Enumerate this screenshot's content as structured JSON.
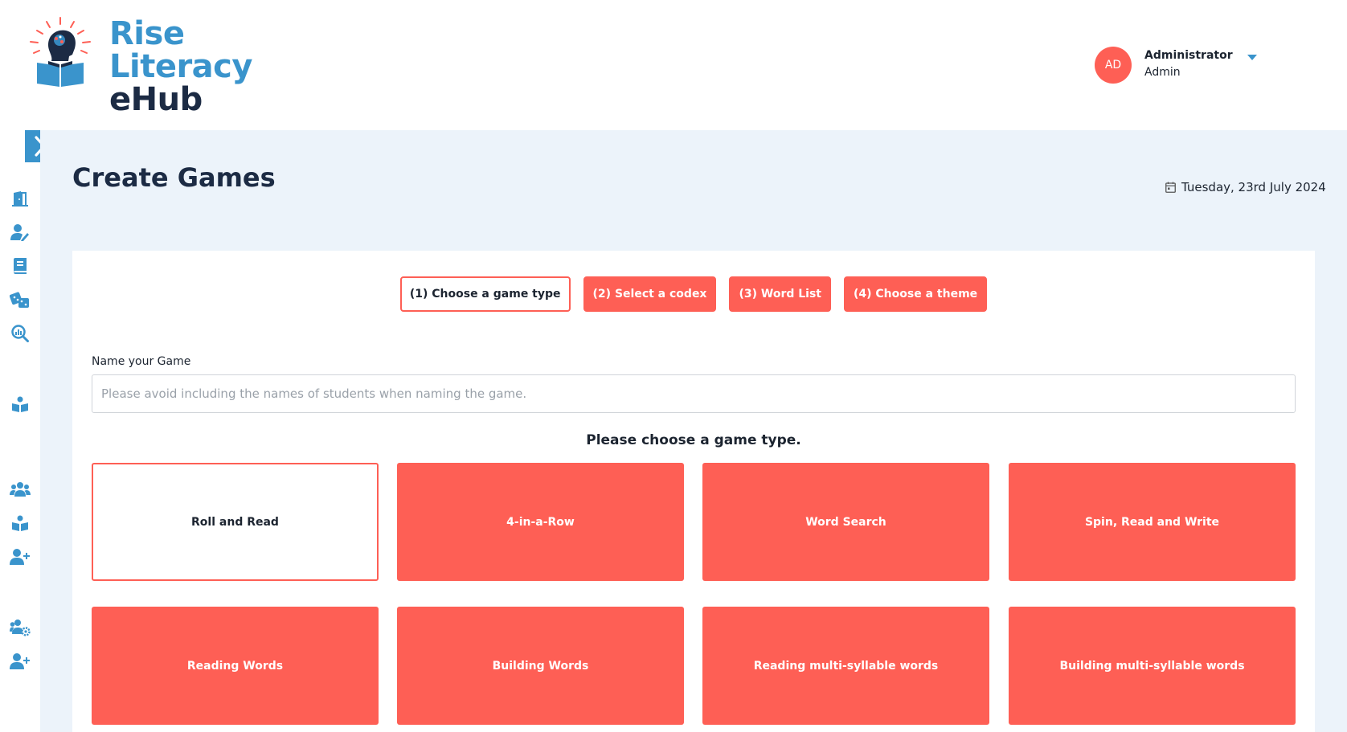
{
  "brand": {
    "line1": "Rise",
    "line2": "Literacy",
    "line3": "eHub",
    "primary_color": "#3a94cc",
    "accent_color": "#fe5f55",
    "dark_color": "#1c2b44"
  },
  "user": {
    "initials": "AD",
    "name": "Administrator",
    "role": "Admin"
  },
  "sidebar": {
    "toggle_icon": "double-chevron-right-icon",
    "items": [
      {
        "icon": "door-icon"
      },
      {
        "icon": "user-edit-icon"
      },
      {
        "icon": "book-icon"
      },
      {
        "icon": "dice-icon"
      },
      {
        "icon": "search-chart-icon"
      },
      {
        "icon": "reading-icon"
      },
      {
        "icon": "users-icon"
      },
      {
        "icon": "reading-icon"
      },
      {
        "icon": "user-plus-icon"
      },
      {
        "icon": "users-cog-icon"
      },
      {
        "icon": "user-plus-icon"
      }
    ]
  },
  "page": {
    "title": "Create Games",
    "date": "Tuesday, 23rd July 2024"
  },
  "steps": [
    {
      "label": "(1) Choose a game type",
      "active": true
    },
    {
      "label": "(2) Select a codex",
      "active": false
    },
    {
      "label": "(3) Word List",
      "active": false
    },
    {
      "label": "(4) Choose a theme",
      "active": false
    }
  ],
  "form": {
    "name_label": "Name your Game",
    "name_value": "",
    "name_placeholder": "Please avoid including the names of students when naming the game."
  },
  "game_prompt": "Please choose a game type.",
  "game_types": [
    {
      "label": "Roll and Read",
      "selected": true
    },
    {
      "label": "4-in-a-Row",
      "selected": false
    },
    {
      "label": "Word Search",
      "selected": false
    },
    {
      "label": "Spin, Read and Write",
      "selected": false
    },
    {
      "label": "Reading Words",
      "selected": false
    },
    {
      "label": "Building Words",
      "selected": false
    },
    {
      "label": "Reading multi-syllable words",
      "selected": false
    },
    {
      "label": "Building multi-syllable words",
      "selected": false
    }
  ]
}
